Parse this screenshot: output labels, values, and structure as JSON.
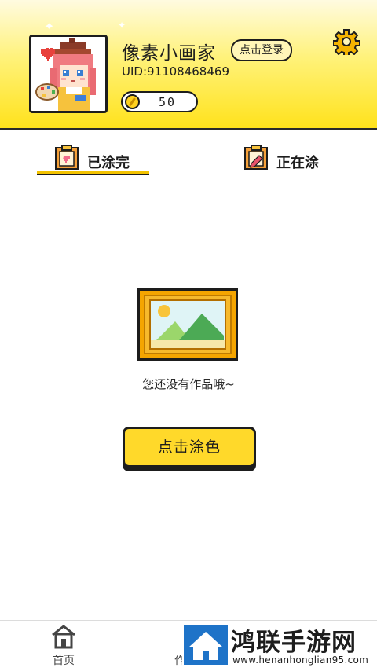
{
  "profile": {
    "nickname": "像素小画家",
    "login_label": "点击登录",
    "uid": "UID:91108468469",
    "coins": "50"
  },
  "tabs": [
    {
      "label": "已涂完",
      "active": true
    },
    {
      "label": "正在涂",
      "active": false
    }
  ],
  "empty_state": {
    "message": "您还没有作品哦~",
    "cta_label": "点击涂色"
  },
  "bottom_nav": {
    "items": [
      {
        "label": "首页",
        "icon": "home-icon"
      },
      {
        "label": "作",
        "icon": "mine-icon"
      }
    ]
  },
  "watermark": {
    "title": "鸿联手游网",
    "url": "www.henanhonglian95.com"
  },
  "colors": {
    "accent_yellow": "#ffd92a",
    "frame_orange": "#f5a500",
    "outline": "#1d1d1d"
  }
}
